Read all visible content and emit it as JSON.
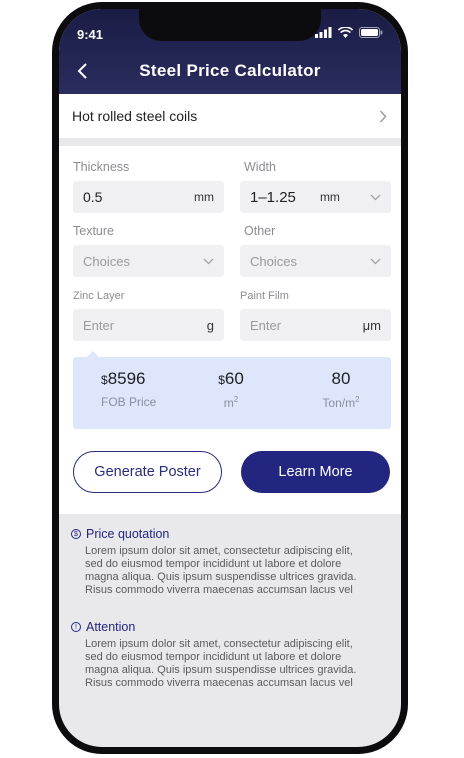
{
  "status_bar": {
    "time": "9:41"
  },
  "header": {
    "title": "Steel Price Calculator"
  },
  "product": {
    "label": "Hot rolled steel coils"
  },
  "form": {
    "thickness": {
      "label": "Thickness",
      "value": "0.5",
      "unit": "mm"
    },
    "width": {
      "label": "Width",
      "value": "1–1.25",
      "unit": "mm"
    },
    "texture": {
      "label": "Texture",
      "placeholder": "Choices"
    },
    "other": {
      "label": "Other",
      "placeholder": "Choices"
    },
    "zinc": {
      "label": "Zinc Layer",
      "placeholder": "Enter",
      "unit": "g"
    },
    "paint": {
      "label": "Paint Film",
      "placeholder": "Enter",
      "unit": "μm"
    }
  },
  "price": {
    "fob": {
      "currency": "$",
      "value": "8596",
      "caption": "FOB Price"
    },
    "per_area": {
      "currency": "$",
      "value": "60",
      "caption": "m",
      "caption_sup": "2"
    },
    "per_ton": {
      "value": "80",
      "caption": "Ton/m",
      "caption_sup": "2"
    }
  },
  "buttons": {
    "generate": "Generate Poster",
    "learn": "Learn More"
  },
  "quotation": {
    "title": "Price quotation",
    "icon": "dollar-circle-icon",
    "lines": [
      "Lorem ipsum dolor sit amet, consectetur adipiscing elit,",
      "sed do eiusmod tempor incididunt ut labore et dolore",
      "magna aliqua. Quis ipsum suspendisse ultrices gravida.",
      "Risus commodo viverra maecenas accumsan lacus vel"
    ]
  },
  "attention": {
    "title": "Attention",
    "icon": "info-circle-icon",
    "lines": [
      "Lorem ipsum dolor sit amet, consectetur adipiscing elit,",
      "sed do eiusmod tempor incididunt ut labore et dolore",
      "magna aliqua. Quis ipsum suspendisse ultrices gravida.",
      "Risus commodo viverra maecenas accumsan lacus vel"
    ]
  },
  "colors": {
    "header": "#1a1c45",
    "accent": "#232680",
    "price_bg": "#dde6fb",
    "page_bg": "#e9e9ec"
  }
}
